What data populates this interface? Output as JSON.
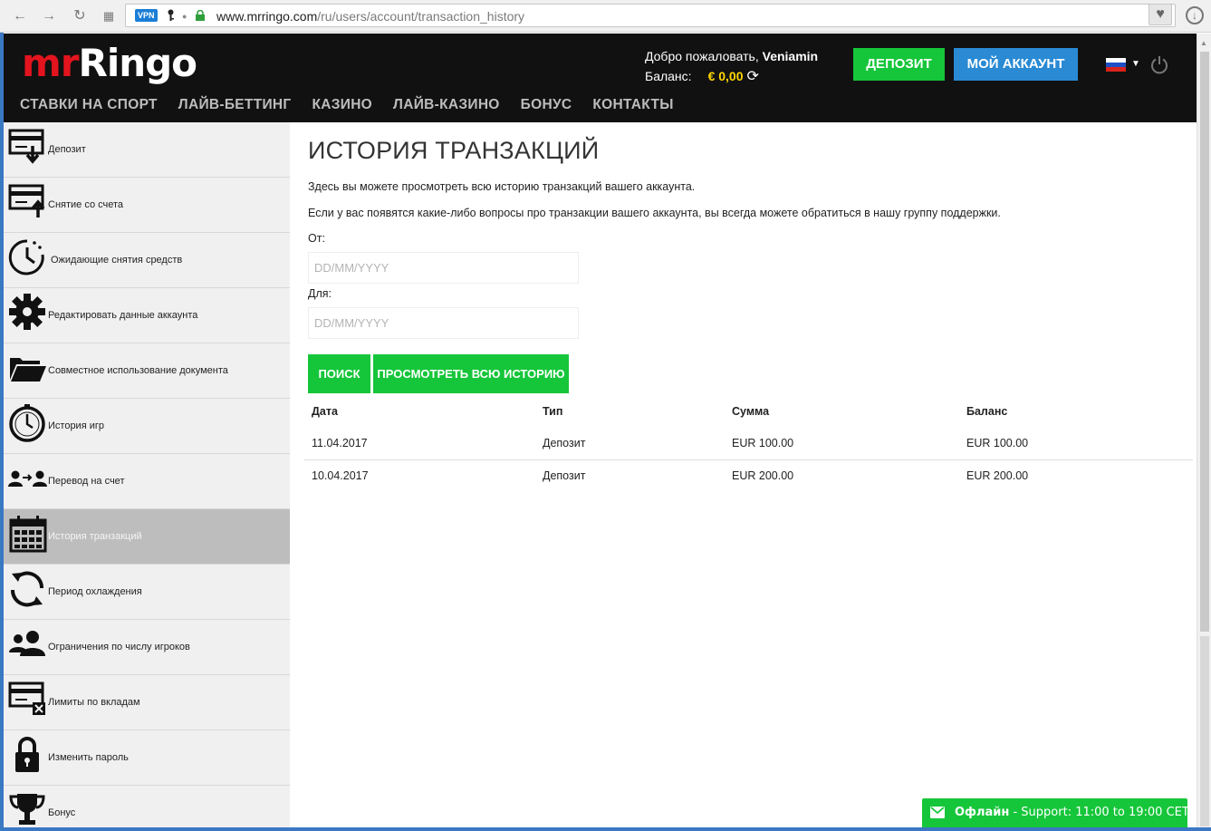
{
  "browser": {
    "url_domain": "www.mrringo.com",
    "url_path": "/ru/users/account/transaction_history",
    "vpn_badge": "VPN"
  },
  "header": {
    "logo_mr": "mr",
    "logo_ringo": "Ringo",
    "welcome_prefix": "Добро пожаловать,",
    "username": "Veniamin",
    "balance_label": "Баланс:",
    "balance_value": "€ 0,00",
    "deposit_button": "ДЕПОЗИТ",
    "account_button": "МОЙ АККАУНТ",
    "language": "Russian",
    "nav": [
      "СТАВКИ НА СПОРТ",
      "ЛАЙВ-БЕТТИНГ",
      "КАЗИНО",
      "ЛАЙВ-КАЗИНО",
      "БОНУС",
      "КОНТАКТЫ"
    ]
  },
  "sidebar": {
    "items": [
      {
        "label": "Депозит",
        "icon": "card-arrow-down-icon"
      },
      {
        "label": "Снятие со счета",
        "icon": "card-arrow-up-icon"
      },
      {
        "label": "Ожидающие снятия средств",
        "icon": "clock-icon"
      },
      {
        "label": "Редактировать данные аккаунта",
        "icon": "gear-icon"
      },
      {
        "label": "Совместное использование документа",
        "icon": "folder-icon"
      },
      {
        "label": "История игр",
        "icon": "clock-face-icon"
      },
      {
        "label": "Перевод на счет",
        "icon": "user-transfer-icon"
      },
      {
        "label": "История транзакций",
        "icon": "calendar-icon",
        "active": true
      },
      {
        "label": "Период охлаждения",
        "icon": "refresh-icon"
      },
      {
        "label": "Ограничения по числу игроков",
        "icon": "users-icon"
      },
      {
        "label": "Лимиты по вкладам",
        "icon": "card-x-icon"
      },
      {
        "label": "Изменить пароль",
        "icon": "lock-icon"
      },
      {
        "label": "Бонус",
        "icon": "trophy-icon"
      }
    ]
  },
  "main": {
    "title": "ИСТОРИЯ ТРАНЗАКЦИЙ",
    "desc1": "Здесь вы можете просмотреть всю историю транзакций вашего аккаунта.",
    "desc2": "Если у вас появятся какие-либо вопросы про транзакции вашего аккаунта, вы всегда можете обратиться в нашу группу поддержки.",
    "from_label": "От:",
    "to_label": "Для:",
    "date_placeholder": "DD/MM/YYYY",
    "search_button": "ПОИСК",
    "view_all_button": "ПРОСМОТРЕТЬ ВСЮ ИСТОРИЮ",
    "table": {
      "headers": [
        "Дата",
        "Тип",
        "Сумма",
        "Баланс"
      ],
      "rows": [
        [
          "11.04.2017",
          "Депозит",
          "EUR 100.00",
          "EUR 100.00"
        ],
        [
          "10.04.2017",
          "Депозит",
          "EUR 200.00",
          "EUR 200.00"
        ]
      ]
    }
  },
  "chat": {
    "status": "Офлайн",
    "text": "- Support: 11:00 to 19:00 CET"
  },
  "colors": {
    "green": "#16c63a",
    "blue": "#2a8ad4",
    "header_bg": "#111111",
    "logo_red": "#e3141e",
    "balance_yellow": "#ffd800"
  }
}
